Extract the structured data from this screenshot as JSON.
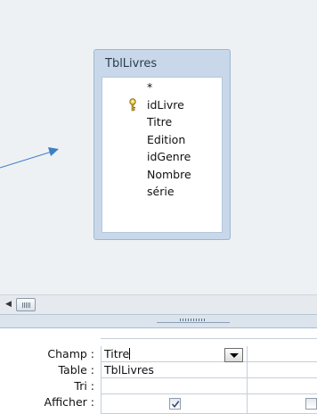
{
  "diagram": {
    "table_name": "TblLivres",
    "fields": [
      {
        "name": "*",
        "primary_key": false
      },
      {
        "name": "idLivre",
        "primary_key": true
      },
      {
        "name": "Titre",
        "primary_key": false
      },
      {
        "name": "Edition",
        "primary_key": false
      },
      {
        "name": "idGenre",
        "primary_key": false
      },
      {
        "name": "Nombre",
        "primary_key": false
      },
      {
        "name": "série",
        "primary_key": false
      }
    ]
  },
  "grid": {
    "rows": {
      "champ": "Champ :",
      "table": "Table :",
      "tri": "Tri :",
      "afficher": "Afficher :"
    },
    "column1": {
      "champ": "Titre",
      "table": "TblLivres",
      "tri": "",
      "afficher": true
    },
    "column2": {
      "champ": "",
      "table": "",
      "tri": "",
      "afficher": false
    }
  },
  "icons": {
    "primary_key": "key-icon",
    "scroll_left": "scroll-left-arrow-icon",
    "dropdown": "dropdown-arrow-icon",
    "checkbox_checked": "checkmark-icon"
  },
  "colors": {
    "table_header": "#c8d8ea",
    "accent_arrow": "#3d7fc4"
  }
}
